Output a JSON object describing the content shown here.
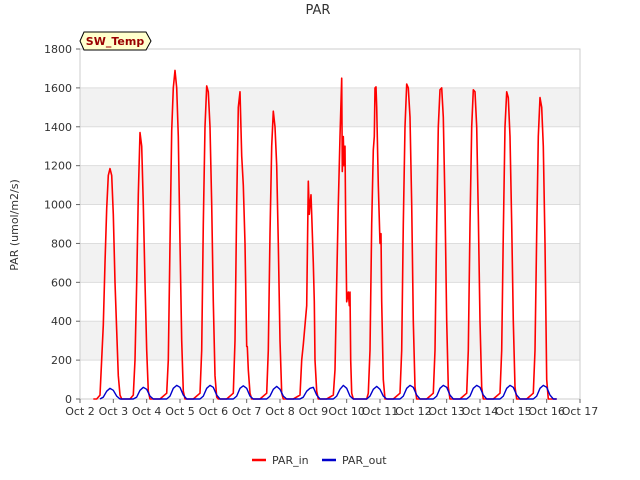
{
  "chart_data": {
    "type": "line",
    "title": "PAR",
    "xlabel": "",
    "ylabel": "PAR (umol/m2/s)",
    "tag": "SW_Temp",
    "xlim": [
      2,
      17
    ],
    "ylim": [
      0,
      1800
    ],
    "x_ticks": [
      2,
      3,
      4,
      5,
      6,
      7,
      8,
      9,
      10,
      11,
      12,
      13,
      14,
      15,
      16,
      17
    ],
    "x_tick_labels": [
      "Oct 2",
      "Oct 3",
      "Oct 4",
      "Oct 5",
      "Oct 6",
      "Oct 7",
      "Oct 8",
      "Oct 9",
      "Oct 10",
      "Oct 11",
      "Oct 12",
      "Oct 13",
      "Oct 14",
      "Oct 15",
      "Oct 16",
      "Oct 17"
    ],
    "y_ticks": [
      0,
      200,
      400,
      600,
      800,
      1000,
      1200,
      1400,
      1600,
      1800
    ],
    "grid": true,
    "legend_position": "bottom",
    "series": [
      {
        "name": "PAR_in",
        "color": "#ff0000",
        "x": [
          2.4,
          2.5,
          2.6,
          2.7,
          2.75,
          2.8,
          2.85,
          2.9,
          2.95,
          3.0,
          3.05,
          3.1,
          3.15,
          3.2,
          3.25,
          3.3,
          3.35,
          3.4,
          3.5,
          3.6,
          3.65,
          3.7,
          3.75,
          3.8,
          3.85,
          3.9,
          3.95,
          4.0,
          4.05,
          4.1,
          4.15,
          4.2,
          4.25,
          4.3,
          4.4,
          4.6,
          4.65,
          4.7,
          4.75,
          4.8,
          4.85,
          4.9,
          4.95,
          5.0,
          5.05,
          5.1,
          5.15,
          5.2,
          5.25,
          5.3,
          5.4,
          5.6,
          5.65,
          5.7,
          5.75,
          5.8,
          5.85,
          5.9,
          5.95,
          6.0,
          6.05,
          6.1,
          6.15,
          6.2,
          6.25,
          6.3,
          6.4,
          6.6,
          6.65,
          6.7,
          6.75,
          6.8,
          6.85,
          6.9,
          6.95,
          7.0,
          7.02,
          7.05,
          7.1,
          7.15,
          7.2,
          7.25,
          7.3,
          7.4,
          7.6,
          7.65,
          7.7,
          7.75,
          7.8,
          7.85,
          7.9,
          7.95,
          8.0,
          8.05,
          8.1,
          8.15,
          8.2,
          8.25,
          8.3,
          8.4,
          8.6,
          8.65,
          8.7,
          8.75,
          8.8,
          8.85,
          8.88,
          8.9,
          8.93,
          8.95,
          9.0,
          9.03,
          9.05,
          9.1,
          9.15,
          9.2,
          9.25,
          9.3,
          9.4,
          9.6,
          9.65,
          9.7,
          9.75,
          9.8,
          9.85,
          9.87,
          9.9,
          9.92,
          9.95,
          9.97,
          10.0,
          10.05,
          10.08,
          10.1,
          10.12,
          10.15,
          10.2,
          10.25,
          10.3,
          10.4,
          10.6,
          10.65,
          10.7,
          10.75,
          10.8,
          10.83,
          10.85,
          10.88,
          10.9,
          10.95,
          11.0,
          11.03,
          11.05,
          11.1,
          11.15,
          11.2,
          11.25,
          11.3,
          11.4,
          11.6,
          11.65,
          11.7,
          11.75,
          11.8,
          11.85,
          11.9,
          11.95,
          12.0,
          12.05,
          12.1,
          12.15,
          12.2,
          12.25,
          12.3,
          12.4,
          12.6,
          12.65,
          12.7,
          12.75,
          12.8,
          12.85,
          12.9,
          12.95,
          13.0,
          13.05,
          13.1,
          13.15,
          13.2,
          13.25,
          13.3,
          13.4,
          13.6,
          13.65,
          13.7,
          13.75,
          13.8,
          13.85,
          13.9,
          13.95,
          14.0,
          14.05,
          14.1,
          14.15,
          14.2,
          14.25,
          14.3,
          14.4,
          14.6,
          14.65,
          14.7,
          14.75,
          14.8,
          14.85,
          14.9,
          14.95,
          15.0,
          15.05,
          15.1,
          15.15,
          15.2,
          15.25,
          15.3,
          15.4,
          15.6,
          15.65,
          15.7,
          15.75,
          15.8,
          15.85,
          15.9,
          15.95,
          16.0,
          16.05,
          16.1,
          16.15,
          16.2,
          16.3
        ],
        "y": [
          0,
          0,
          20,
          380,
          700,
          980,
          1150,
          1185,
          1150,
          950,
          600,
          350,
          120,
          20,
          0,
          0,
          0,
          0,
          0,
          20,
          200,
          600,
          1050,
          1370,
          1300,
          1000,
          600,
          250,
          40,
          0,
          0,
          0,
          0,
          0,
          0,
          30,
          200,
          800,
          1380,
          1600,
          1690,
          1600,
          1350,
          800,
          300,
          40,
          0,
          0,
          0,
          0,
          0,
          30,
          250,
          900,
          1400,
          1610,
          1580,
          1400,
          1000,
          500,
          120,
          10,
          0,
          0,
          0,
          0,
          0,
          30,
          300,
          1000,
          1500,
          1580,
          1250,
          1100,
          800,
          270,
          270,
          150,
          30,
          0,
          0,
          0,
          0,
          0,
          30,
          250,
          850,
          1300,
          1480,
          1400,
          1200,
          800,
          300,
          30,
          0,
          0,
          0,
          0,
          0,
          0,
          20,
          200,
          280,
          380,
          480,
          1120,
          950,
          1000,
          1050,
          950,
          700,
          500,
          200,
          40,
          0,
          0,
          0,
          0,
          0,
          20,
          150,
          600,
          1000,
          1350,
          1650,
          1170,
          1350,
          1200,
          1300,
          900,
          500,
          550,
          480,
          550,
          200,
          30,
          0,
          0,
          0,
          0,
          0,
          30,
          250,
          900,
          1280,
          1350,
          1600,
          1605,
          1500,
          1100,
          800,
          850,
          500,
          100,
          0,
          0,
          0,
          0,
          0,
          30,
          250,
          900,
          1400,
          1620,
          1600,
          1450,
          1000,
          400,
          60,
          0,
          0,
          0,
          0,
          0,
          0,
          30,
          250,
          900,
          1400,
          1590,
          1600,
          1450,
          1000,
          400,
          60,
          0,
          0,
          0,
          0,
          0,
          0,
          30,
          250,
          900,
          1400,
          1590,
          1580,
          1400,
          950,
          400,
          60,
          0,
          0,
          0,
          0,
          0,
          0,
          30,
          250,
          850,
          1400,
          1580,
          1550,
          1350,
          900,
          400,
          60,
          0,
          0,
          0,
          0,
          0,
          0,
          30,
          250,
          850,
          1350,
          1550,
          1500,
          1300,
          800,
          100,
          0,
          0,
          0,
          0,
          0
        ]
      },
      {
        "name": "PAR_out",
        "color": "#0000cc",
        "x": [
          2.6,
          2.7,
          2.8,
          2.9,
          3.0,
          3.1,
          3.2,
          3.3,
          3.6,
          3.7,
          3.8,
          3.9,
          4.0,
          4.1,
          4.2,
          4.3,
          4.6,
          4.7,
          4.8,
          4.9,
          5.0,
          5.1,
          5.2,
          5.3,
          5.6,
          5.7,
          5.8,
          5.9,
          6.0,
          6.1,
          6.2,
          6.3,
          6.6,
          6.7,
          6.8,
          6.9,
          7.0,
          7.1,
          7.2,
          7.3,
          7.6,
          7.7,
          7.8,
          7.9,
          8.0,
          8.1,
          8.2,
          8.3,
          8.6,
          8.7,
          8.8,
          8.9,
          9.0,
          9.1,
          9.2,
          9.3,
          9.6,
          9.7,
          9.8,
          9.9,
          10.0,
          10.1,
          10.2,
          10.3,
          10.6,
          10.7,
          10.8,
          10.9,
          11.0,
          11.1,
          11.2,
          11.3,
          11.6,
          11.7,
          11.8,
          11.9,
          12.0,
          12.1,
          12.2,
          12.3,
          12.6,
          12.7,
          12.8,
          12.9,
          13.0,
          13.1,
          13.2,
          13.3,
          13.6,
          13.7,
          13.8,
          13.9,
          14.0,
          14.1,
          14.2,
          14.3,
          14.6,
          14.7,
          14.8,
          14.9,
          15.0,
          15.1,
          15.2,
          15.3,
          15.6,
          15.7,
          15.8,
          15.9,
          16.0,
          16.1,
          16.2,
          16.3
        ],
        "y": [
          0,
          10,
          40,
          55,
          45,
          15,
          0,
          0,
          0,
          10,
          45,
          60,
          50,
          15,
          0,
          0,
          0,
          15,
          55,
          70,
          60,
          20,
          0,
          0,
          0,
          15,
          55,
          70,
          60,
          20,
          0,
          0,
          0,
          15,
          55,
          68,
          55,
          15,
          0,
          0,
          0,
          15,
          50,
          65,
          50,
          15,
          0,
          0,
          0,
          10,
          40,
          55,
          60,
          20,
          0,
          0,
          0,
          15,
          50,
          70,
          55,
          15,
          0,
          0,
          0,
          15,
          50,
          65,
          50,
          15,
          0,
          0,
          0,
          15,
          55,
          70,
          60,
          20,
          0,
          0,
          0,
          15,
          55,
          70,
          60,
          20,
          0,
          0,
          0,
          15,
          55,
          70,
          60,
          20,
          0,
          0,
          0,
          15,
          55,
          70,
          60,
          20,
          0,
          0,
          0,
          15,
          55,
          70,
          60,
          20,
          0,
          0
        ]
      }
    ]
  }
}
